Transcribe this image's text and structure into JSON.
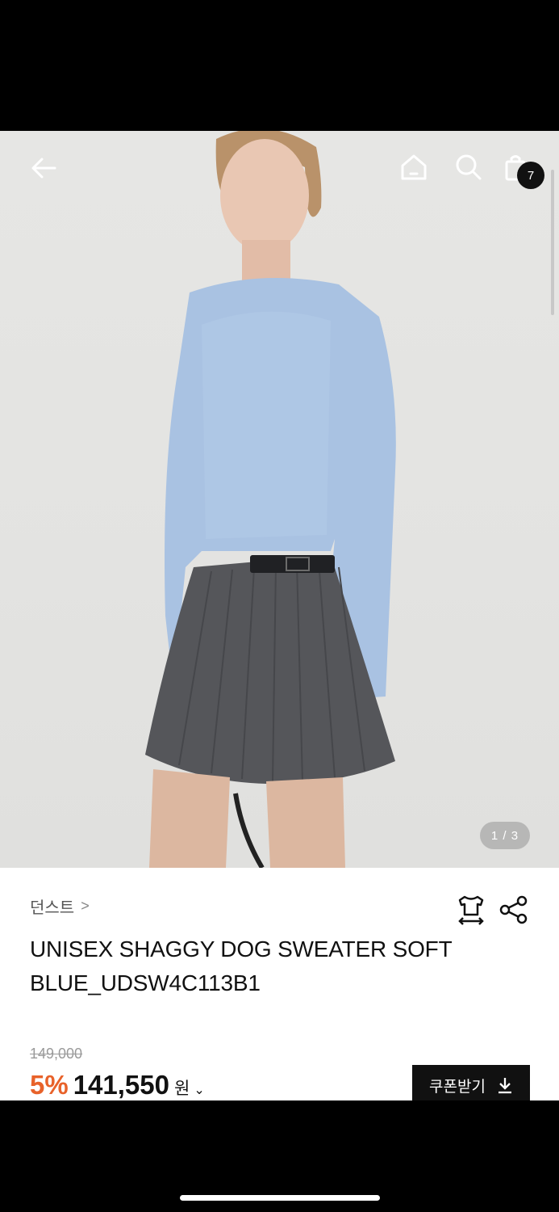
{
  "nav": {
    "back_icon": "arrow-left-icon",
    "home_icon": "home-icon",
    "search_icon": "search-icon",
    "bag_icon": "shopping-bag-icon",
    "cart_count": "7"
  },
  "gallery": {
    "counter": "1 / 3"
  },
  "product": {
    "brand": "던스트",
    "brand_chevron": ">",
    "title": "UNISEX SHAGGY DOG SWEATER SOFT BLUE_UDSW4C113B1",
    "original_price": "149,000",
    "discount": "5%",
    "price": "141,550",
    "currency": "원",
    "price_chevron": "⌄"
  },
  "actions": {
    "size_icon": "size-guide-icon",
    "share_icon": "share-icon",
    "coupon_label": "쿠폰받기",
    "coupon_icon": "download-icon"
  },
  "colors": {
    "accent_discount": "#e8622a",
    "button_bg": "#111111",
    "sweater": "#a9c2e2",
    "skirt": "#55565a"
  }
}
